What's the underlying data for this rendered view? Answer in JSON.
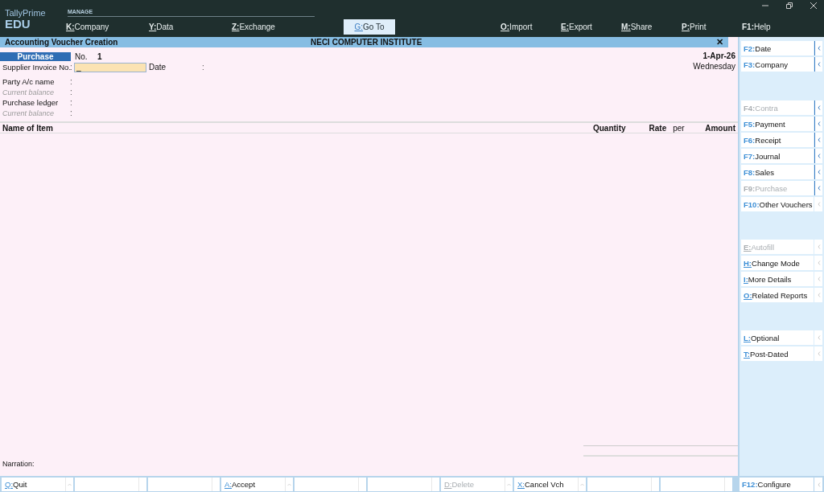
{
  "app": {
    "name": "TallyPrime",
    "edition": "EDU",
    "section": "MANAGE"
  },
  "menu_left": [
    {
      "key": "K:",
      "label": "Company"
    },
    {
      "key": "Y:",
      "label": "Data"
    },
    {
      "key": "Z:",
      "label": "Exchange"
    }
  ],
  "goto_button": {
    "key": "G:",
    "label": "Go To"
  },
  "menu_right": [
    {
      "key": "O:",
      "label": "Import",
      "underlined": true
    },
    {
      "key": "E:",
      "label": "Export",
      "underlined": true
    },
    {
      "key": "M:",
      "label": "Share",
      "underlined": true
    },
    {
      "key": "P:",
      "label": "Print",
      "underlined": true
    },
    {
      "key": "F1:",
      "label": "Help",
      "underlined": false
    }
  ],
  "title_bar": {
    "title": "Accounting Voucher Creation",
    "company": "NECI COMPUTER INSTITUTE",
    "close": "✕"
  },
  "voucher": {
    "type": "Purchase",
    "no_label": "No.",
    "number": "1",
    "date": "1-Apr-26",
    "weekday": "Wednesday"
  },
  "fields": [
    {
      "label": "Supplier Invoice No.",
      "sep": ":",
      "kind": "input",
      "value": "_",
      "extra_label": "Date",
      "extra_sep": ":"
    },
    {
      "label": "Party A/c name",
      "sep": ":",
      "kind": "plain"
    },
    {
      "label": "Current balance",
      "sep": ":",
      "kind": "muted"
    },
    {
      "label": "Purchase ledger",
      "sep": ":",
      "kind": "plain"
    },
    {
      "label": "Current balance",
      "sep": ":",
      "kind": "muted"
    }
  ],
  "table": {
    "columns": [
      "Name of Item",
      "Quantity",
      "Rate",
      "per",
      "Amount"
    ]
  },
  "narration": {
    "label": "Narration:"
  },
  "sidebar": [
    [
      {
        "key": "F2:",
        "label": "Date",
        "disabled": false,
        "arrow_active": true
      },
      {
        "key": "F3:",
        "label": "Company",
        "disabled": false,
        "arrow_active": true
      }
    ],
    [
      {
        "key": "F4:",
        "label": "Contra",
        "disabled": true,
        "arrow_active": true
      },
      {
        "key": "F5:",
        "label": "Payment",
        "disabled": false,
        "arrow_active": true
      },
      {
        "key": "F6:",
        "label": "Receipt",
        "disabled": false,
        "arrow_active": true
      },
      {
        "key": "F7:",
        "label": "Journal",
        "disabled": false,
        "arrow_active": true
      },
      {
        "key": "F8:",
        "label": "Sales",
        "disabled": false,
        "arrow_active": true
      },
      {
        "key": "F9:",
        "label": "Purchase",
        "disabled": true,
        "arrow_active": true
      },
      {
        "key": "F10:",
        "label": "Other Vouchers",
        "disabled": false,
        "arrow_active": false
      }
    ],
    [
      {
        "key": "E:",
        "label": "Autofill",
        "disabled": true,
        "arrow_active": false,
        "underlined": true
      },
      {
        "key": "H:",
        "label": "Change Mode",
        "disabled": false,
        "arrow_active": false,
        "underlined": true
      },
      {
        "key": "I:",
        "label": "More Details",
        "disabled": false,
        "arrow_active": false,
        "underlined": true
      },
      {
        "key": "O:",
        "label": "Related Reports",
        "disabled": false,
        "arrow_active": false,
        "underlined": true
      }
    ],
    [
      {
        "key": "L:",
        "label": "Optional",
        "disabled": false,
        "arrow_active": false,
        "underlined": true
      },
      {
        "key": "T:",
        "label": "Post-Dated",
        "disabled": false,
        "arrow_active": false,
        "underlined": true
      }
    ]
  ],
  "configure": {
    "key": "F12:",
    "label": "Configure",
    "disabled": false,
    "arrow_active": false
  },
  "bottom_bar": [
    {
      "kind": "button",
      "key": "Q:",
      "label": "Quit",
      "disabled": false
    },
    {
      "kind": "empty"
    },
    {
      "kind": "empty"
    },
    {
      "kind": "button",
      "key": "A:",
      "label": "Accept",
      "disabled": false
    },
    {
      "kind": "empty"
    },
    {
      "kind": "empty"
    },
    {
      "kind": "button",
      "key": "D:",
      "label": "Delete",
      "disabled": true
    },
    {
      "kind": "button",
      "key": "X:",
      "label": "Cancel Vch",
      "disabled": false
    },
    {
      "kind": "empty"
    },
    {
      "kind": "empty"
    }
  ]
}
